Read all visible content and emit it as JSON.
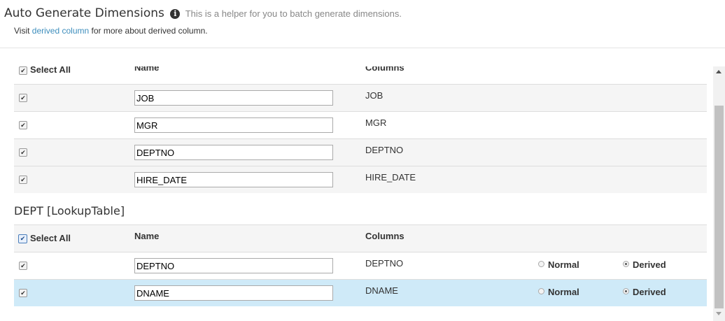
{
  "header": {
    "title": "Auto Generate Dimensions",
    "helper": "This is a helper for you to batch generate dimensions.",
    "visit_prefix": "Visit",
    "visit_link": "derived column",
    "visit_suffix": "for more about derived column."
  },
  "fact_table": {
    "header": {
      "select_all": "Select All",
      "name": "Name",
      "columns": "Columns"
    },
    "rows": [
      {
        "name": "JOB",
        "column": "JOB",
        "checked": true
      },
      {
        "name": "MGR",
        "column": "MGR",
        "checked": true
      },
      {
        "name": "DEPTNO",
        "column": "DEPTNO",
        "checked": true
      },
      {
        "name": "HIRE_DATE",
        "column": "HIRE_DATE",
        "checked": true
      }
    ]
  },
  "lookup_table": {
    "title": "DEPT [LookupTable]",
    "header": {
      "select_all": "Select All",
      "name": "Name",
      "columns": "Columns"
    },
    "rows": [
      {
        "name": "DEPTNO",
        "column": "DEPTNO",
        "normal_label": "Normal",
        "derived_label": "Derived",
        "selected": "Derived"
      },
      {
        "name": "DNAME",
        "column": "DNAME",
        "normal_label": "Normal",
        "derived_label": "Derived",
        "selected": "Derived"
      }
    ]
  },
  "colors": {
    "link": "#3c8dbc",
    "highlight_row": "#cfeaf8",
    "striped_row": "#f5f5f5"
  },
  "icons": {
    "info": "info-circle-icon",
    "checkbox": "checkbox-checked-icon"
  }
}
